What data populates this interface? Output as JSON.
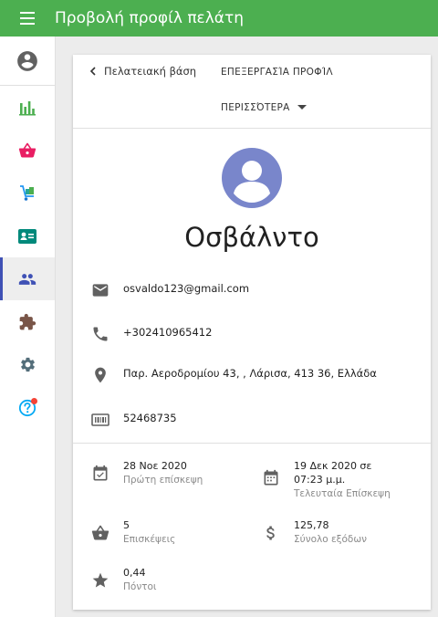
{
  "header": {
    "title": "Προβολή προφίλ πελάτη"
  },
  "sidebar": {
    "items": [
      {
        "icon": "account-circle-icon"
      },
      {
        "icon": "bar-chart-icon"
      },
      {
        "icon": "basket-icon"
      },
      {
        "icon": "delivery-icon"
      },
      {
        "icon": "contact-card-icon"
      },
      {
        "icon": "people-icon",
        "active": true
      },
      {
        "icon": "puzzle-icon"
      },
      {
        "icon": "gear-icon"
      },
      {
        "icon": "help-icon",
        "badge": true
      }
    ]
  },
  "card": {
    "back_label": "Πελατειακή βάση",
    "edit_label": "ΕΠΕΞΕΡΓΑΣΊΑ ΠΡΟΦΊΛ",
    "more_label": "ΠΕΡΙΣΣΌΤΕΡΑ",
    "name": "Οσβάλντο",
    "email": "osvaldo123@gmail.com",
    "phone": "+302410965412",
    "address": "Παρ. Αεροδρομίου 43, , Λάρισα, 413 36, Ελλάδα",
    "card_number": "52468735",
    "stats": {
      "first_visit": {
        "value": "28 Νοε 2020",
        "label": "Πρώτη επίσκεψη"
      },
      "last_visit": {
        "value_line1": "19 Δεκ 2020 σε",
        "value_line2": "07:23 μ.μ.",
        "label": "Τελευταία Επίσκεψη"
      },
      "visits": {
        "value": "5",
        "label": "Επισκέψεις"
      },
      "total_spent": {
        "value": "125,78",
        "label": "Σύνολο εξόδων"
      },
      "points": {
        "value": "0,44",
        "label": "Πόντοι"
      }
    }
  },
  "colors": {
    "header": "#4caf50",
    "accent": "#3f51b5",
    "avatar": "#7986cb",
    "icon_gray": "#616161"
  }
}
